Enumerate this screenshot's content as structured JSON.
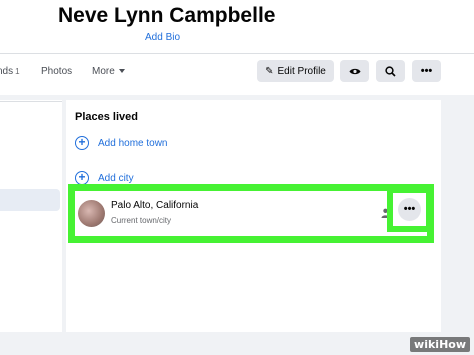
{
  "profile": {
    "name": "Neve Lynn Campbelle",
    "add_bio": "Add Bio"
  },
  "tabs": {
    "friends_label": "nds",
    "friends_count": "1",
    "photos_label": "Photos",
    "more_label": "More"
  },
  "actions": {
    "edit_profile": "Edit Profile",
    "view_as_icon": "eye-icon",
    "search_icon": "search-icon",
    "more_icon": "more-dots-icon"
  },
  "places": {
    "title": "Places lived",
    "add_home_town": "Add home town",
    "add_city": "Add city",
    "entry": {
      "name": "Palo Alto, California",
      "subtitle": "Current town/city",
      "privacy_icon": "friends-icon",
      "more_icon": "more-dots-icon"
    }
  },
  "watermark": {
    "wiki": "wiki",
    "how": "How"
  },
  "colors": {
    "highlight": "#46f233",
    "link_blue": "#216fdb",
    "button_grey": "#e4e6eb",
    "page_bg": "#f0f2f5"
  }
}
